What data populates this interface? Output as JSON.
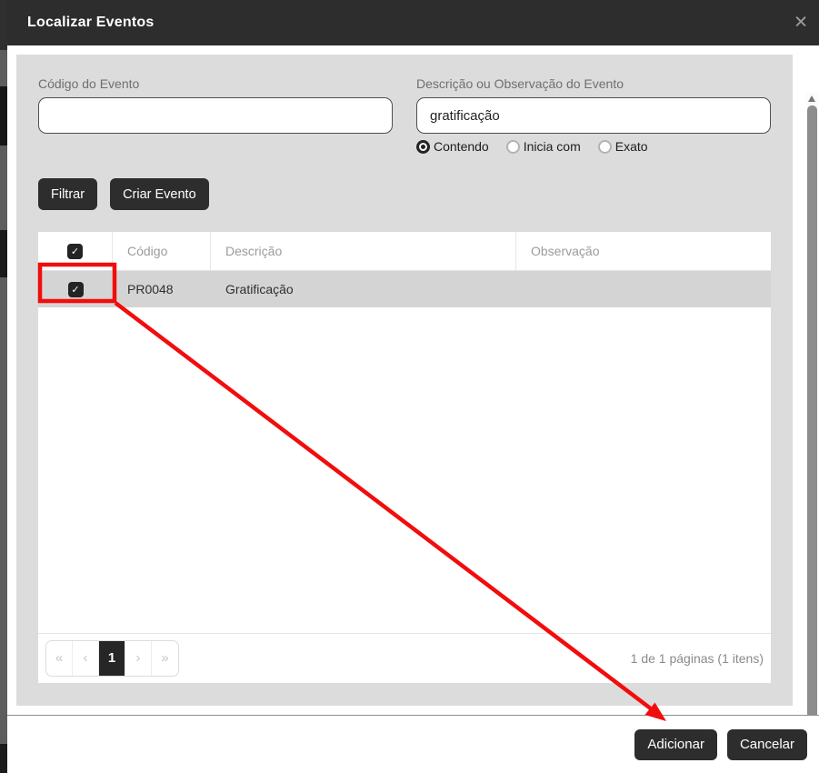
{
  "modal": {
    "title": "Localizar Eventos"
  },
  "icons": {
    "close": "✕",
    "check": "✓"
  },
  "filters": {
    "codigo_label": "Código do Evento",
    "codigo_value": "",
    "descricao_label": "Descrição ou Observação do Evento",
    "descricao_value": "gratificação",
    "match_options": [
      {
        "label": "Contendo",
        "selected": true
      },
      {
        "label": "Inicia com",
        "selected": false
      },
      {
        "label": "Exato",
        "selected": false
      }
    ]
  },
  "actions": {
    "filtrar": "Filtrar",
    "criar_evento": "Criar Evento",
    "adicionar": "Adicionar",
    "cancelar": "Cancelar"
  },
  "table": {
    "columns": {
      "codigo": "Código",
      "descricao": "Descrição",
      "observacao": "Observação"
    },
    "rows": [
      {
        "selected": true,
        "codigo": "PR0048",
        "descricao": "Gratificação",
        "observacao": ""
      }
    ]
  },
  "pagination": {
    "first": "«",
    "prev": "‹",
    "current_page": "1",
    "next": "›",
    "last": "»",
    "info": "1 de 1 páginas (1 itens)"
  },
  "colors": {
    "header_bg": "#2d2d2d",
    "panel_bg": "#dcdcdc",
    "button_bg": "#2d2d2d",
    "selected_row_bg": "#d4d4d4",
    "annotation_red": "#f20d0d"
  },
  "annotation": {
    "description": "red box highlighting selected row checkbox, arrow pointing to Adicionar button"
  }
}
